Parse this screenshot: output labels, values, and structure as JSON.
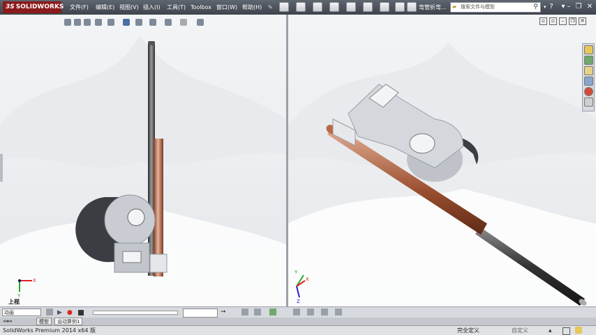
{
  "app": {
    "brand": "SOLIDWORKS",
    "brand_prefix": "3S"
  },
  "menu": [
    "文件(F)",
    "编辑(E)",
    "视图(V)",
    "插入(I)",
    "工具(T)",
    "Toolbox",
    "窗口(W)",
    "帮助(H)"
  ],
  "document_title": "弯管折弯...",
  "search": {
    "placeholder": "搜索文件与模型"
  },
  "viewports": {
    "left": {
      "orientation_label": "上视"
    },
    "right": {
      "orientation_label": ""
    }
  },
  "triad": {
    "x": "X",
    "y": "Y",
    "z": "Z"
  },
  "motion": {
    "study_type": "动画",
    "time_value": ""
  },
  "tabs": [
    "模型",
    "运动算例1"
  ],
  "status": {
    "product": "SolidWorks Premium 2014 x64 版",
    "state": "完全定义",
    "units": "自定义"
  },
  "colors": {
    "menu_bg": "#3e444c",
    "viewport_bg": "#f3f4f6",
    "rod_steel": "#4a4a4a",
    "rod_copper": "#b06a48",
    "part_grey": "#c9ccd2"
  },
  "icons": [
    "pin-icon",
    "home-icon",
    "library-icon",
    "explorer-icon",
    "appearance-icon",
    "custom-props-icon"
  ]
}
